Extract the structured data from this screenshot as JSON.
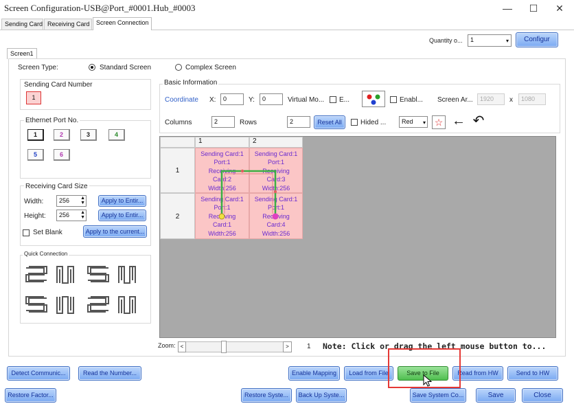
{
  "window": {
    "title": "Screen Configuration-USB@Port_#0001.Hub_#0003",
    "controls": {
      "minimize": "—",
      "maximize": "☐",
      "close": "✕"
    }
  },
  "tabs": [
    {
      "label": "Sending Card"
    },
    {
      "label": "Receiving Card"
    },
    {
      "label": "Screen Connection"
    }
  ],
  "top": {
    "quantity_label": "Quantity o...",
    "quantity_value": "1",
    "configure_label": "Configur"
  },
  "screen_tab": "Screen1",
  "screen_type": {
    "label": "Screen Type:",
    "standard": "Standard Screen",
    "complex": "Complex Screen"
  },
  "sending_card_number": {
    "label": "Sending Card Number",
    "value": "1"
  },
  "ethernet_port": {
    "label": "Ethernet Port No.",
    "ports": [
      "1",
      "2",
      "3",
      "4",
      "5",
      "6"
    ]
  },
  "receiving_card_size": {
    "label": "Receiving Card Size",
    "width_label": "Width:",
    "width_value": "256",
    "height_label": "Height:",
    "height_value": "256",
    "apply_entire_label": "Apply to Entir...",
    "set_blank_label": "Set Blank",
    "apply_current_label": "Apply to the current..."
  },
  "quick_connection": {
    "label": "Quick Connection"
  },
  "basic_info": {
    "label": "Basic Information",
    "coordinate_label": "Coordinate",
    "x_label": "X:",
    "x_value": "0",
    "y_label": "Y:",
    "y_value": "0",
    "virtual_mode_label": "Virtual Mo...",
    "e_label": "E...",
    "enable_label": "Enabl...",
    "screen_area_label": "Screen Ar...",
    "screen_w": "1920",
    "x_sep": "x",
    "screen_h": "1080",
    "columns_label": "Columns",
    "columns_value": "2",
    "rows_label": "Rows",
    "rows_value": "2",
    "reset_all_label": "Reset All",
    "hided_label": "Hided ...",
    "color_value": "Red",
    "star": "☆",
    "arrow_left": "←",
    "undo": "↶"
  },
  "grid": {
    "col_headers": [
      "1",
      "2"
    ],
    "row_headers": [
      "1",
      "2"
    ],
    "cells": [
      [
        "Sending Card:1",
        "Port:1",
        "Receiving",
        "Card:2",
        "Width:256"
      ],
      [
        "Sending Card:1",
        "Port:1",
        "Receiving",
        "Card:3",
        "Width:256"
      ],
      [
        "Sending Card:1",
        "Port:1",
        "Receiving",
        "Card:1",
        "Width:256"
      ],
      [
        "Sending Card:1",
        "Port:1",
        "Receiving",
        "Card:4",
        "Width:256"
      ]
    ]
  },
  "zoom": {
    "label": "Zoom:",
    "left": "<",
    "right": ">",
    "value": "1",
    "note": "Note: Click or drag the left mouse button to..."
  },
  "bottom_row1": {
    "detect": "Detect Communic...",
    "read_number": "Read the Number...",
    "enable_mapping": "Enable Mapping",
    "load_from_file": "Load from File",
    "save_to_file": "Save to File",
    "read_from_hw": "Read from HW",
    "send_to_hw": "Send to HW"
  },
  "bottom_row2": {
    "restore_factory": "Restore Factor...",
    "restore_system": "Restore Syste...",
    "back_up_system": "Back Up Syste...",
    "save_system_config": "Save System Co...",
    "save": "Save",
    "close": "Close"
  },
  "colors": {
    "accent_blue": "#7aa9f2",
    "highlight_red": "#e53935",
    "cell_pink": "#fbc6c6",
    "cell_text": "#6a2bd0",
    "green_button": "#4fbe4f"
  }
}
